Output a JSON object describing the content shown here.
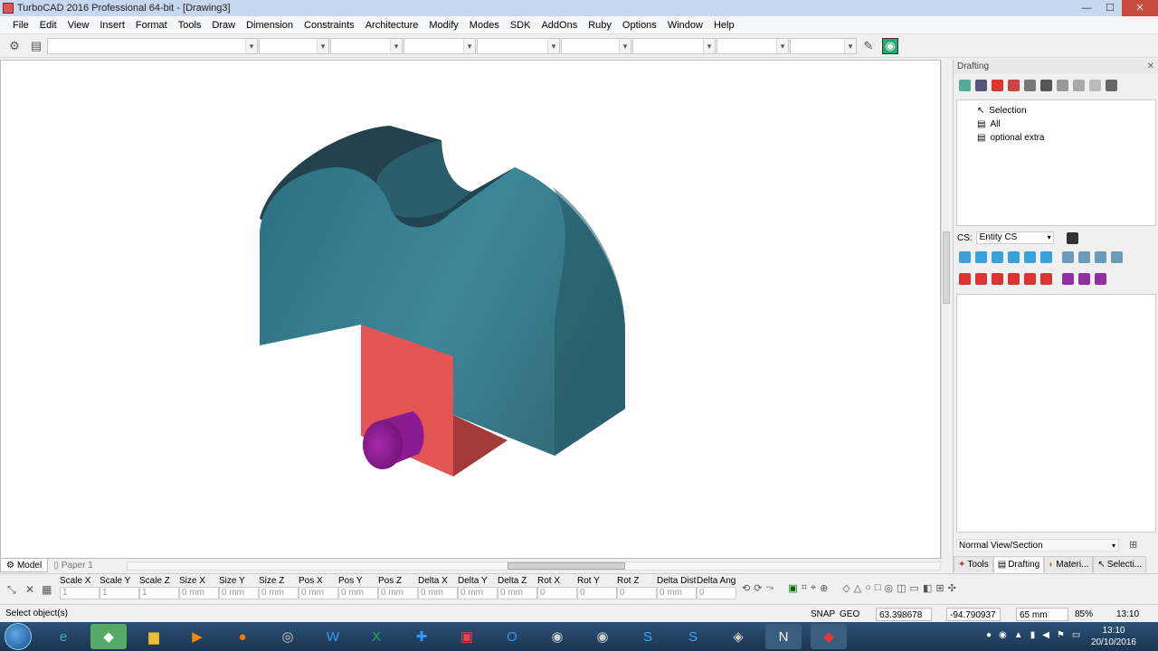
{
  "window": {
    "title": "TurboCAD 2016 Professional 64-bit - [Drawing3]"
  },
  "menu": [
    "File",
    "Edit",
    "View",
    "Insert",
    "Format",
    "Tools",
    "Draw",
    "Dimension",
    "Constraints",
    "Architecture",
    "Modify",
    "Modes",
    "SDK",
    "AddOns",
    "Ruby",
    "Options",
    "Window",
    "Help"
  ],
  "tabs": {
    "model": "Model",
    "paper": "Paper 1"
  },
  "inspector": {
    "fields": [
      {
        "label": "Scale X",
        "value": "1"
      },
      {
        "label": "Scale Y",
        "value": "1"
      },
      {
        "label": "Scale Z",
        "value": "1"
      },
      {
        "label": "Size X",
        "value": "0 mm"
      },
      {
        "label": "Size Y",
        "value": "0 mm"
      },
      {
        "label": "Size Z",
        "value": "0 mm"
      },
      {
        "label": "Pos X",
        "value": "0 mm"
      },
      {
        "label": "Pos Y",
        "value": "0 mm"
      },
      {
        "label": "Pos Z",
        "value": "0 mm"
      },
      {
        "label": "Delta X",
        "value": "0 mm"
      },
      {
        "label": "Delta Y",
        "value": "0 mm"
      },
      {
        "label": "Delta Z",
        "value": "0 mm"
      },
      {
        "label": "Rot X",
        "value": "0"
      },
      {
        "label": "Rot Y",
        "value": "0"
      },
      {
        "label": "Rot Z",
        "value": "0"
      },
      {
        "label": "Delta Dist",
        "value": "0 mm"
      },
      {
        "label": "Delta Ang",
        "value": "0"
      }
    ]
  },
  "status": {
    "message": "Select object(s)",
    "snap": "SNAP",
    "geo": "GEO",
    "x": "63.398678 m",
    "y": "-94.790937 m",
    "z": "65 mm",
    "zoom": "85%",
    "time": "13:10"
  },
  "panel": {
    "title": "Drafting",
    "tree": [
      "Selection",
      "All",
      "optional extra"
    ],
    "cs_label": "CS:",
    "cs_value": "Entity CS",
    "view_section": "Normal View/Section",
    "tabs": [
      "Tools",
      "Drafting",
      "Materi...",
      "Selecti..."
    ]
  },
  "taskbar": {
    "clock_time": "13:10",
    "clock_date": "20/10/2016"
  },
  "colors": {
    "teal": "#2f6d7c",
    "red": "#e05050",
    "purple": "#8a1a8f"
  }
}
